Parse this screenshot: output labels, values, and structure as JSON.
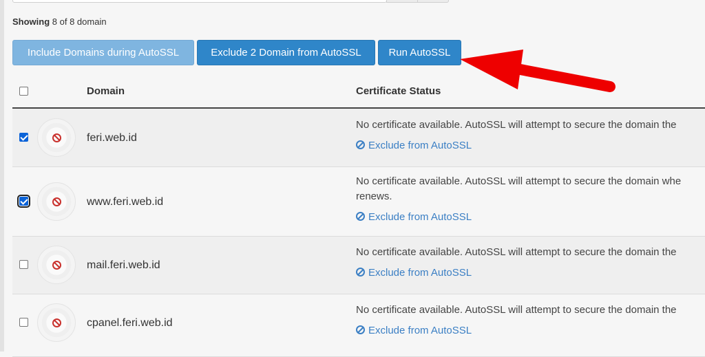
{
  "showing": {
    "label": "Showing",
    "text": "8 of 8 domain"
  },
  "actions": {
    "include_label": "Include Domains during AutoSSL",
    "exclude_label": "Exclude 2 Domain from AutoSSL",
    "run_label": "Run AutoSSL"
  },
  "table": {
    "headers": {
      "domain": "Domain",
      "status": "Certificate Status"
    },
    "rows": [
      {
        "domain": "feri.web.id",
        "checked": true,
        "message": "No certificate available. AutoSSL will attempt to secure the domain the",
        "link": "Exclude from AutoSSL"
      },
      {
        "domain": "www.feri.web.id",
        "checked": true,
        "message": "No certificate available. AutoSSL will attempt to secure the domain whe",
        "message_cont": "renews.",
        "link": "Exclude from AutoSSL"
      },
      {
        "domain": "mail.feri.web.id",
        "checked": false,
        "message": "No certificate available. AutoSSL will attempt to secure the domain the",
        "link": "Exclude from AutoSSL"
      },
      {
        "domain": "cpanel.feri.web.id",
        "checked": false,
        "message": "No certificate available. AutoSSL will attempt to secure the domain the",
        "link": "Exclude from AutoSSL"
      }
    ]
  },
  "colors": {
    "primary": "#2f86c9",
    "primary_light": "#7fb5e0",
    "danger": "#c9302c",
    "link": "#3b7fc4",
    "annotation_arrow": "#ee0000"
  },
  "icons": {
    "status": "ban-icon",
    "exclude": "ban-icon",
    "annotation": "red-arrow"
  }
}
